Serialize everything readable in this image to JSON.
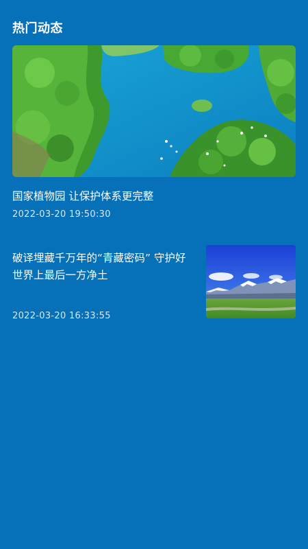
{
  "section": {
    "title": "热门动态"
  },
  "articles": [
    {
      "title": "国家植物园 让保护体系更完整",
      "time": "2022-03-20 19:50:30",
      "image": "aerial-lake-forest-image"
    },
    {
      "title": "破译埋藏千万年的“青藏密码” 守护好世界上最后一方净土",
      "time": "2022-03-20 16:33:55",
      "image": "snow-mountain-grassland-image"
    }
  ],
  "colors": {
    "background": "#0670b8",
    "text": "#ffffff",
    "subtext": "#dbe8f4"
  }
}
